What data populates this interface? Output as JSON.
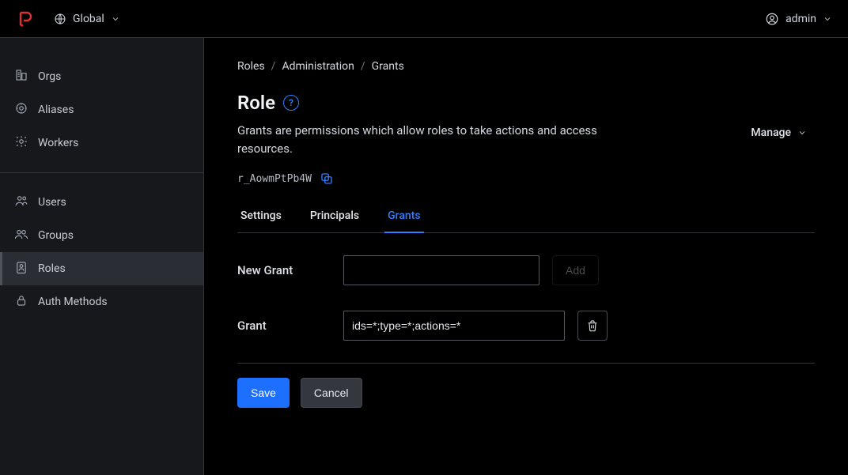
{
  "header": {
    "scope_label": "Global",
    "user_label": "admin"
  },
  "sidebar": {
    "section1": [
      {
        "key": "orgs",
        "label": "Orgs"
      },
      {
        "key": "aliases",
        "label": "Aliases"
      },
      {
        "key": "workers",
        "label": "Workers"
      }
    ],
    "section2": [
      {
        "key": "users",
        "label": "Users"
      },
      {
        "key": "groups",
        "label": "Groups"
      },
      {
        "key": "roles",
        "label": "Roles"
      },
      {
        "key": "auth-methods",
        "label": "Auth Methods"
      }
    ],
    "active_key": "roles"
  },
  "breadcrumbs": {
    "items": [
      "Roles",
      "Administration",
      "Grants"
    ]
  },
  "page": {
    "title": "Role",
    "description": "Grants are permissions which allow roles to take actions and access resources.",
    "role_id": "r_AowmPtPb4W",
    "manage_label": "Manage"
  },
  "tabs": {
    "items": [
      "Settings",
      "Principals",
      "Grants"
    ],
    "active_index": 2
  },
  "form": {
    "new_grant_label": "New Grant",
    "new_grant_value": "",
    "add_button": "Add",
    "grant_label": "Grant",
    "grant_value": "ids=*;type=*;actions=*",
    "save_button": "Save",
    "cancel_button": "Cancel"
  }
}
